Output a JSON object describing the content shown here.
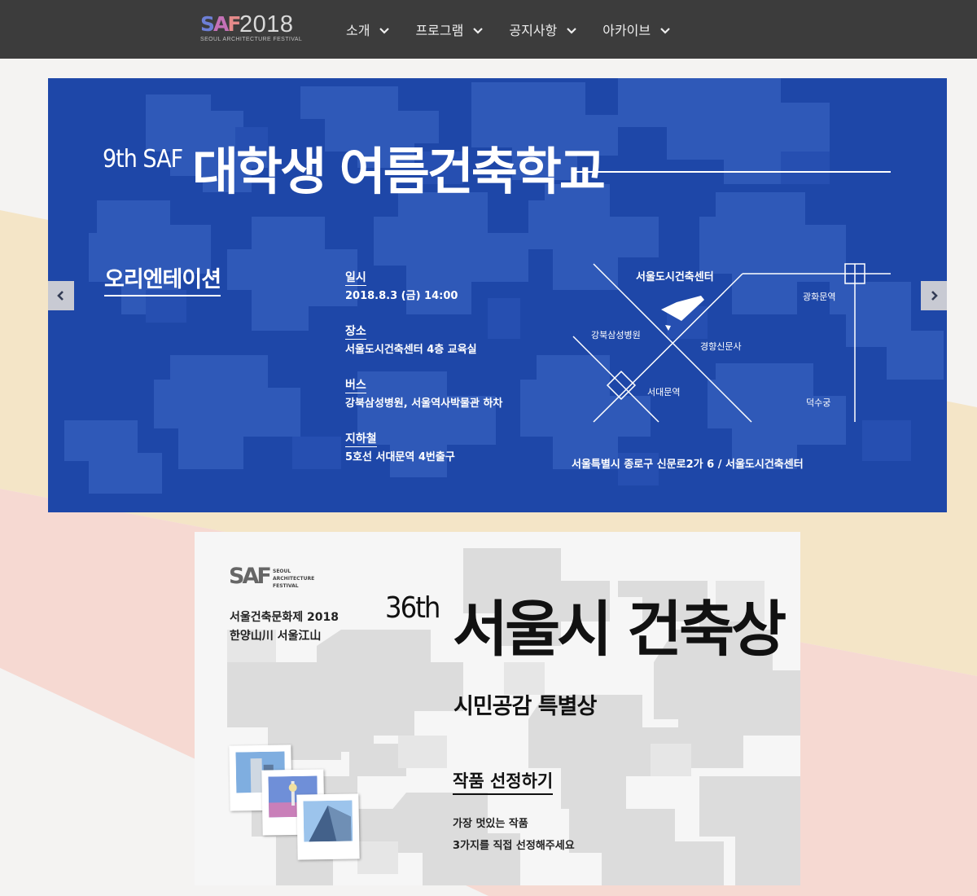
{
  "header": {
    "logo_mark": [
      "S",
      "A",
      "F"
    ],
    "logo_year": "2018",
    "logo_sub": "SEOUL ARCHITECTURE FESTIVAL",
    "nav": [
      {
        "label": "소개"
      },
      {
        "label": "프로그램"
      },
      {
        "label": "공지사항"
      },
      {
        "label": "아카이브"
      }
    ]
  },
  "banner1": {
    "edition": "9th SAF",
    "title": "대학생 여름건축학교",
    "subtitle": "오리엔테이션",
    "info": [
      {
        "label": "일시",
        "value": "2018.8.3 (금) 14:00"
      },
      {
        "label": "장소",
        "value": "서울도시건축센터 4층 교육실"
      },
      {
        "label": "버스",
        "value": "강북삼성병원, 서울역사박물관 하차"
      },
      {
        "label": "지하철",
        "value": "5호선 서대문역 4번출구"
      }
    ],
    "map_labels": {
      "center": "서울도시건축센터",
      "gwanghwamun": "광화문역",
      "hospital": "강북삼성병원",
      "kyunghyang": "경향신문사",
      "seodaemun": "서대문역",
      "deoksugung": "덕수궁"
    },
    "address": "서울특별시 종로구 신문로2가 6 / 서울도시건축센터",
    "colors": {
      "background": "#1e47a8",
      "text": "#ffffff"
    }
  },
  "slider": {
    "prev_icon": "chevron-left-icon",
    "next_icon": "chevron-right-icon"
  },
  "banner2": {
    "logo_mark": "SAF",
    "logo_text": "SEOUL ARCHITECTURE FESTIVAL",
    "festival_line1": "서울건축문화제 2018",
    "festival_line2": "한양山川 서울江山",
    "edition": "36th",
    "title": "서울시 건축상",
    "subtitle": "시민공감 특별상",
    "cta": "작품 선정하기",
    "desc_line1": "가장 멋있는 작품",
    "desc_line2": "3가지를 직접 선정해주세요"
  }
}
